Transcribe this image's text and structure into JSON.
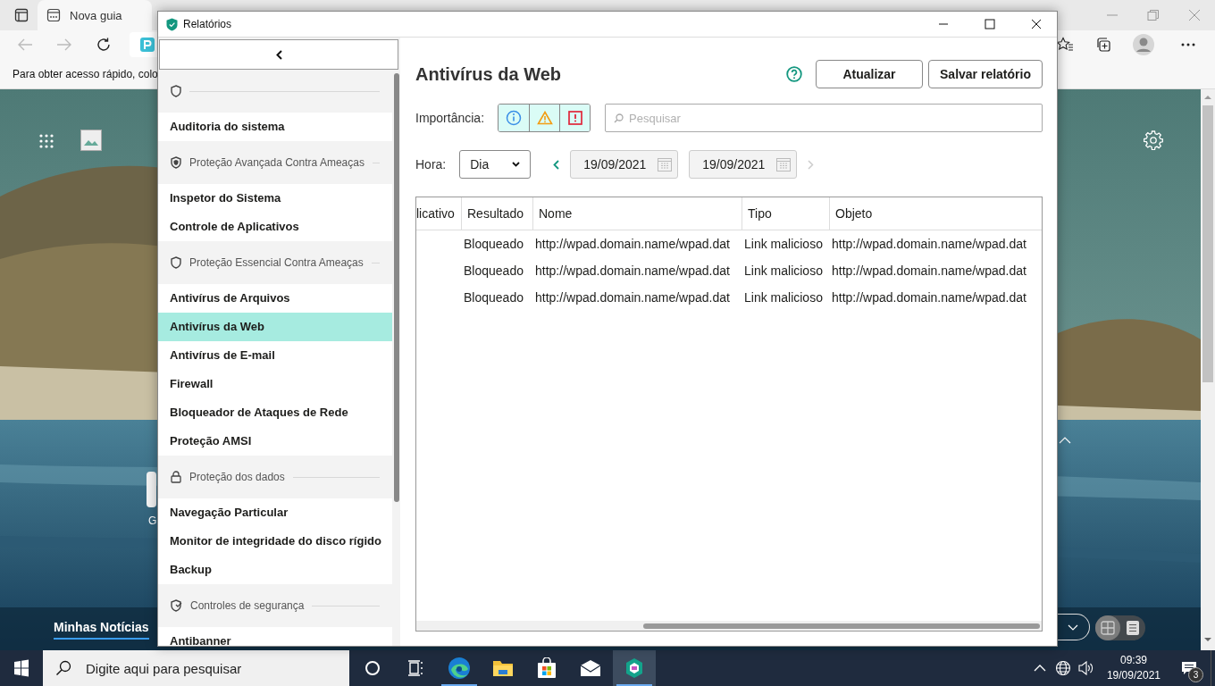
{
  "browser": {
    "tab": {
      "title": "Nova guia"
    },
    "favorites_bar": {
      "text": "Para obter acesso rápido, colo"
    },
    "new_tab_page": {
      "tile": {
        "label": "G"
      },
      "news_tab": {
        "label": "Minhas Notícias",
        "selected": true
      },
      "view_toggle": [
        {
          "selected": true
        },
        {
          "selected": false
        }
      ]
    }
  },
  "window": {
    "title": "Relatórios"
  },
  "sidebar": {
    "sections": [
      {
        "items": [
          {
            "label": "Auditoria do sistema",
            "selected": false
          }
        ]
      },
      {
        "label": "Proteção Avançada Contra Ameaças",
        "items": [
          {
            "label": "Inspetor do Sistema",
            "selected": false
          },
          {
            "label": "Controle de Aplicativos",
            "selected": false
          }
        ]
      },
      {
        "label": "Proteção Essencial Contra Ameaças",
        "items": [
          {
            "label": "Antivírus de Arquivos",
            "selected": false
          },
          {
            "label": "Antivírus da Web",
            "selected": true
          },
          {
            "label": "Antivírus de E-mail",
            "selected": false
          },
          {
            "label": "Firewall",
            "selected": false
          },
          {
            "label": "Bloqueador de Ataques de Rede",
            "selected": false
          },
          {
            "label": "Proteção AMSI",
            "selected": false
          }
        ]
      },
      {
        "label": "Proteção dos dados",
        "items": [
          {
            "label": "Navegação Particular",
            "selected": false
          },
          {
            "label": "Monitor de integridade do disco rígido",
            "selected": false
          },
          {
            "label": "Backup",
            "selected": false
          }
        ]
      },
      {
        "label": "Controles de segurança",
        "items": [
          {
            "label": "Antibanner",
            "selected": false
          }
        ]
      }
    ]
  },
  "main": {
    "title": "Antivírus da Web",
    "buttons": [
      "Atualizar",
      "Salvar relatório"
    ],
    "importance": {
      "label": "Importância:",
      "levels": [
        {
          "kind": "info",
          "selected": true
        },
        {
          "kind": "warning",
          "selected": true
        },
        {
          "kind": "critical",
          "selected": true
        }
      ]
    },
    "search": {
      "placeholder": "Pesquisar"
    },
    "period": {
      "label": "Hora:",
      "value": "Dia",
      "previous": {
        "disabled": false
      },
      "start": "19/09/2021",
      "end": "19/09/2021",
      "next": {
        "disabled": true
      }
    },
    "table": {
      "columns": [
        "licativo",
        "Resultado",
        "Nome",
        "Tipo",
        "Objeto"
      ],
      "rows": [
        {
          "cells": [
            "",
            "Bloqueado",
            "http://wpad.domain.name/wpad.dat",
            "Link malicioso",
            "http://wpad.domain.name/wpad.dat"
          ]
        },
        {
          "cells": [
            "",
            "Bloqueado",
            "http://wpad.domain.name/wpad.dat",
            "Link malicioso",
            "http://wpad.domain.name/wpad.dat"
          ]
        },
        {
          "cells": [
            "",
            "Bloqueado",
            "http://wpad.domain.name/wpad.dat",
            "Link malicioso",
            "http://wpad.domain.name/wpad.dat"
          ]
        }
      ]
    }
  },
  "taskbar": {
    "search": {
      "placeholder": "Digite aqui para pesquisar"
    },
    "apps": [
      {
        "kind": "edge",
        "running": true,
        "active": false
      },
      {
        "kind": "explorer",
        "running": false,
        "active": false
      },
      {
        "kind": "store",
        "running": false,
        "active": false
      },
      {
        "kind": "mail",
        "running": false,
        "active": false
      },
      {
        "kind": "kaspersky",
        "running": true,
        "active": true
      }
    ],
    "clock": {
      "time": "09:39",
      "date": "19/09/2021"
    },
    "notifications": {
      "count": "3"
    }
  }
}
